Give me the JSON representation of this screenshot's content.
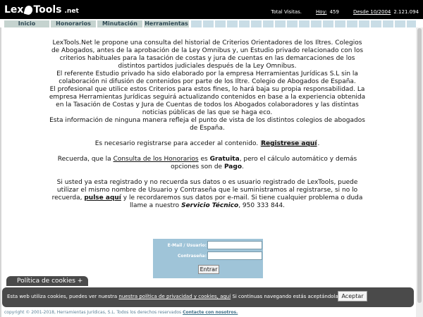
{
  "header": {
    "logo": {
      "lex": "Lex",
      "tools": "Tools",
      "net": ".net"
    },
    "total_visits_label": "Total Visitas.",
    "today_label": "Hoy:",
    "today_value": "459",
    "since_label": "Desde 10/2004",
    "since_value": "2.121.094"
  },
  "nav": {
    "tabs": [
      "Inicio",
      "Honorarios",
      "Minutación",
      "Herramientas"
    ]
  },
  "main": {
    "intro_lines": [
      "LexTools.Net le propone una consulta del historial de Criterios Orientadores de los Iltres. Colegios",
      "de Abogados, antes de la aprobación de la Ley Omnibus y, un Estudio privado relacionado con los",
      "criterios habituales para la tasación de costas y jura de cuentas en las demarcaciones de los",
      "distintos partidos judiciales después de la Ley Omnibus.",
      "El referente Estudio privado ha sido elaborado por la empresa Herramientas Jurídicas S.L sin la",
      "colaboración ni difusión de contenidos por parte de los Iltre. Colegio de Abogados de España.",
      "El profesional que utilice estos Criterios para estos fines, lo hará baja su propia responsabilidad. La",
      "empresa Herramientas Jurídicas seguirá actualizando contenidos en base a la experiencia obtenida",
      "en la Tasación de Costas y Jura de Cuentas de todos los Abogados colaboradores y las distintas",
      "noticias públicas de las que se haga eco.",
      "Esta información de ninguna manera refleja el punto de vista de los distintos colegios de abogados",
      "de España."
    ],
    "register_text": "Es necesario registrarse para acceder al contenido.",
    "register_link": "Registrese aquí",
    "register_end": ".",
    "fees_prefix": "Recuerda, que la",
    "fees_link": "Consulta de los Honorarios",
    "fees_mid": "es",
    "fees_free": "Gratuita",
    "fees_line1_end": ", pero el cálculo automático y demás",
    "fees_line2_start": "opciones son de",
    "fees_paid": "Pago",
    "fees_end": ".",
    "registered_line1": "Si usted ya esta registrado y no recuerda sus datos o es usuario registrado de LexTools, puede",
    "registered_line2": "utilizar el mismo nombre de Usuario y Contraseña que le suministramos al registrarse, si no lo",
    "registered_line3_start": "recuerda,",
    "registered_link": "pulse aquí",
    "registered_line3_end": "y le recordaremos sus datos por e-mail. Si tiene cualquier problema o duda",
    "registered_line4_start": "llame a nuestro",
    "tech_service": "Servicio Técnico",
    "phone": ", 950 333 844."
  },
  "login": {
    "email_label": "E-Mail / Usuario:",
    "password_label": "Contraseña:",
    "email_value": "",
    "password_value": "",
    "submit_label": "Entrar"
  },
  "cookies": {
    "tab_label": "Política de cookies +",
    "text_start": "Esta web utiliza cookies, puedes ver nuestra",
    "policy_link": "nuestra política de privacidad y cookies, aquí",
    "text_end": "Si continuas navegando estás aceptándola",
    "accept_label": "Aceptar"
  },
  "footer": {
    "copyright": "copyright © 2001-2018, Herramientas Jurídicas, S.L. Todos los derechos reservados",
    "contact_link": "Contacte con nosotros."
  },
  "colors": {
    "header_bg": "#000000",
    "tab_bg": "#c5d3cf",
    "tab_text": "#2f4a55",
    "login_bg": "#9fc4d8",
    "cookie_bg": "#4a4a4a",
    "footer_text": "#5c8096"
  }
}
